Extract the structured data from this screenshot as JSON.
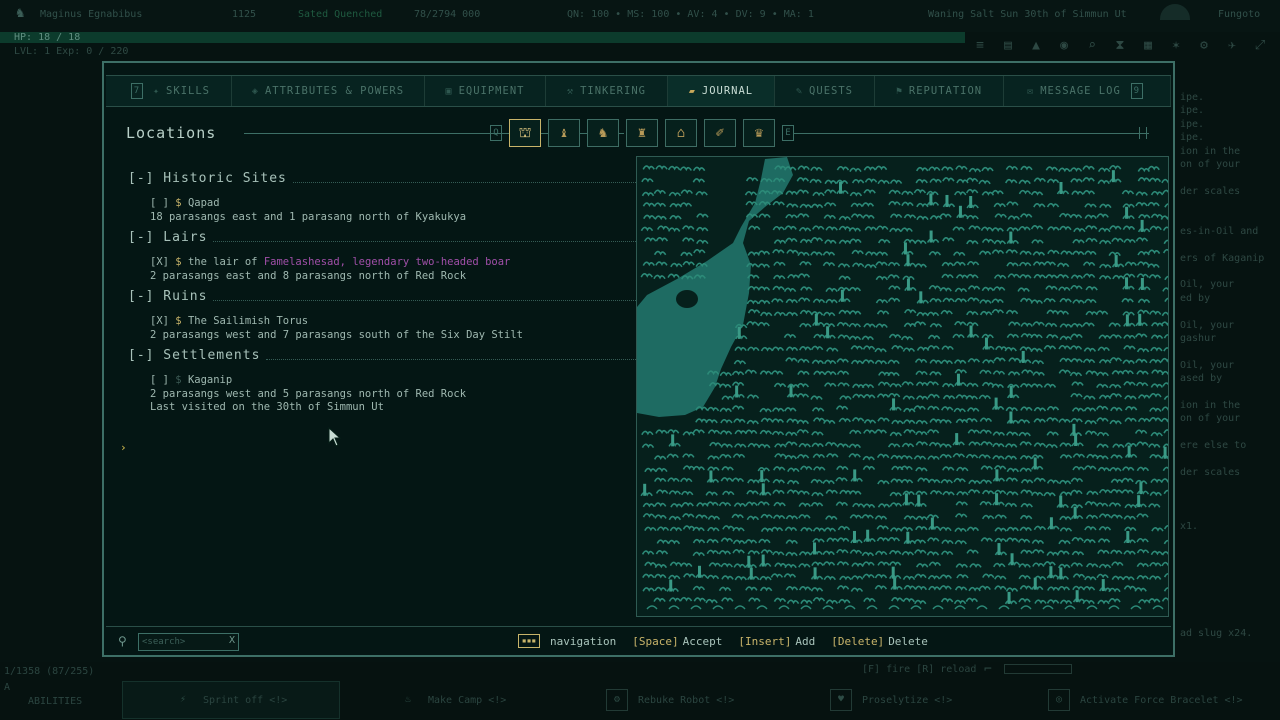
{
  "hud": {
    "player_name": "Maginus Egnabibus",
    "hud_slot_1": "1125",
    "hud_slot_2": "Sated Quenched",
    "hud_slot_3": "78/2794 000",
    "hud_slot_4": "QN: 100 • MS: 100 • AV: 4 • DV: 9 • MA: 1",
    "date": "Waning Salt Sun 30th of Simmun Ut",
    "region": "Fungoto",
    "hp": "HP: 18 / 18",
    "level": "LVL: 1 Exp: 0 / 220",
    "right_log": [
      "ipe.",
      "ipe.",
      "ipe.",
      "ipe.",
      "ion in the",
      "on of your",
      "",
      "der scales",
      "",
      "",
      "es-in-Oil and",
      "",
      "ers of Kaganip",
      "",
      "Oil, your",
      "ed by",
      "",
      "Oil, your",
      "gashur",
      "",
      "Oil, your",
      "ased by",
      "",
      "ion in the",
      "on of your",
      "",
      "ere else to",
      "",
      "der scales",
      "",
      "",
      "",
      "x1.",
      "",
      "",
      "",
      "",
      "",
      "",
      "",
      "ad slug x24."
    ],
    "bottom_left_1": "1/1358 (87/255)",
    "bottom_left_2": "A",
    "bottom_left_3": "ABILITIES",
    "fire_reload": "[F] fire [R] reload",
    "abilities": [
      "Sprint off <!>",
      "Make Camp <!>",
      "Rebuke Robot <!>",
      "Proselytize <!>",
      "Activate Force Bracelet <!>"
    ]
  },
  "tabs": [
    {
      "key": "7",
      "icon": "✦",
      "label": "SKILLS"
    },
    {
      "key": "",
      "icon": "◈",
      "label": "ATTRIBUTES & POWERS"
    },
    {
      "key": "",
      "icon": "▣",
      "label": "EQUIPMENT"
    },
    {
      "key": "",
      "icon": "⚒",
      "label": "TINKERING"
    },
    {
      "key": "",
      "icon": "▰",
      "label": "JOURNAL"
    },
    {
      "key": "",
      "icon": "✎",
      "label": "QUESTS"
    },
    {
      "key": "",
      "icon": "⚑",
      "label": "REPUTATION"
    },
    {
      "key": "9",
      "icon": "✉",
      "label": "MESSAGE LOG"
    }
  ],
  "journal": {
    "section_title": "Locations",
    "filter_key_left": "Q",
    "filter_key_right": "E",
    "filter_icons": [
      "location-filter-icon",
      "chronology-filter-icon",
      "observations-filter-icon",
      "sultan-filter-icon",
      "villages-filter-icon",
      "general-notes-filter-icon",
      "recipes-filter-icon"
    ],
    "categories": [
      {
        "label": "[-] Historic Sites",
        "entries": [
          {
            "mark": "[ ]",
            "dollar": "$",
            "name_pre": "Qapad",
            "name_hl": "",
            "detail": "18 parasangs east and 1 parasang north of Kyakukya"
          }
        ]
      },
      {
        "label": "[-] Lairs",
        "entries": [
          {
            "mark": "[X]",
            "dollar": "$",
            "name_pre": "the lair of ",
            "name_hl": "Famelashesad, legendary two-headed boar",
            "detail": "2 parasangs east and 8 parasangs north of Red Rock"
          }
        ]
      },
      {
        "label": "[-] Ruins",
        "entries": [
          {
            "mark": "[X]",
            "dollar": "$",
            "name_pre": "The Sailimish Torus",
            "name_hl": "",
            "detail": "2 parasangs west and 7 parasangs south of the Six Day Stilt"
          }
        ]
      },
      {
        "label": "[-] Settlements",
        "entries": [
          {
            "mark": "[ ]",
            "dollar": "$",
            "name_pre": "Kaganip",
            "name_hl": "",
            "detail": "2 parasangs west and 5 parasangs north of Red Rock",
            "extra": "Last visited on the 30th of Simmun Ut"
          }
        ]
      }
    ],
    "selected_marker": "›"
  },
  "footer": {
    "search_placeholder": "<search>",
    "search_clear": "X",
    "nav_box": "▪▪▪",
    "nav_label": "navigation",
    "accept_key": "[Space]",
    "accept_label": "Accept",
    "add_key": "[Insert]",
    "add_label": "Add",
    "delete_key": "[Delete]",
    "delete_label": "Delete"
  },
  "colors": {
    "frame": "#3d6f66",
    "accent_gold": "#c8b46a",
    "highlight_purple": "#a04fa8",
    "map_land": "#0d3a36",
    "map_foliage": "#2c8a78",
    "map_water": "#1e6b62"
  }
}
